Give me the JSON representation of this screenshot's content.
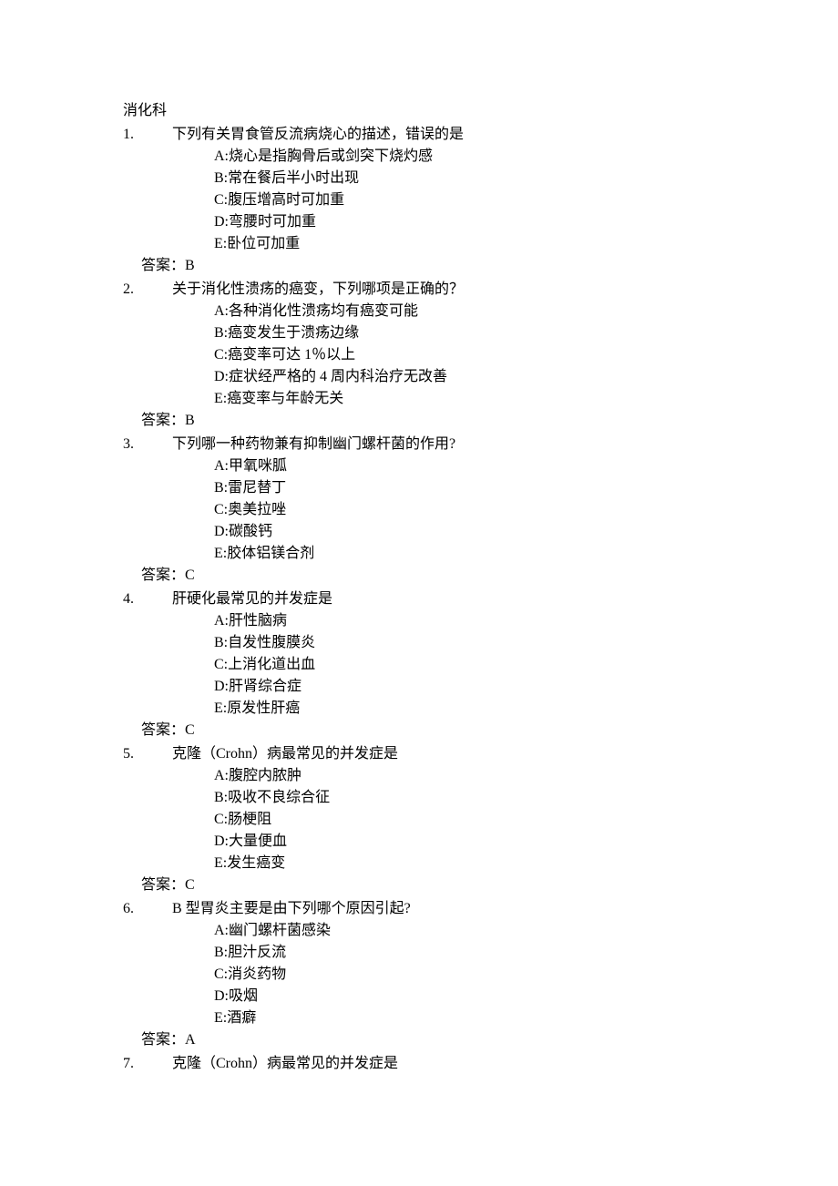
{
  "title": "消化科",
  "questions": [
    {
      "num": "1.",
      "stem": "下列有关胃食管反流病烧心的描述，错误的是",
      "options": [
        "A:烧心是指胸骨后或剑突下烧灼感",
        "B:常在餐后半小时出现",
        "C:腹压增高时可加重",
        "D:弯腰时可加重",
        "E:卧位可加重"
      ],
      "answer": "答案：B"
    },
    {
      "num": "2.",
      "stem": "关于消化性溃疡的癌变，下列哪项是正确的？",
      "options": [
        "A:各种消化性溃疡均有癌变可能",
        "B:癌变发生于溃疡边缘",
        "C:癌变率可达 1％以上",
        "D:症状经严格的 4 周内科治疗无改善",
        "E:癌变率与年龄无关"
      ],
      "answer": "答案：B"
    },
    {
      "num": "3.",
      "stem": "下列哪一种药物兼有抑制幽门螺杆菌的作用?",
      "options": [
        "A:甲氧咪胍",
        "B:雷尼替丁",
        "C:奥美拉唑",
        "D:碳酸钙",
        "E:胶体铝镁合剂"
      ],
      "answer": "答案：C"
    },
    {
      "num": "4.",
      "stem": "肝硬化最常见的并发症是",
      "options": [
        "A:肝性脑病",
        "B:自发性腹膜炎",
        "C:上消化道出血",
        "D:肝肾综合症",
        "E:原发性肝癌"
      ],
      "answer": "答案：C"
    },
    {
      "num": "5.",
      "stem": "克隆（Crohn）病最常见的并发症是",
      "options": [
        "A:腹腔内脓肿",
        "B:吸收不良综合征",
        "C:肠梗阻",
        "D:大量便血",
        "E:发生癌变"
      ],
      "answer": "答案：C"
    },
    {
      "num": "6.",
      "stem": "B 型胃炎主要是由下列哪个原因引起?",
      "options": [
        "A:幽门螺杆菌感染",
        "B:胆汁反流",
        "C:消炎药物",
        "D:吸烟",
        "E:酒癖"
      ],
      "answer": "答案：A"
    },
    {
      "num": "7.",
      "stem": "克隆（Crohn）病最常见的并发症是",
      "options": [],
      "answer": ""
    }
  ]
}
